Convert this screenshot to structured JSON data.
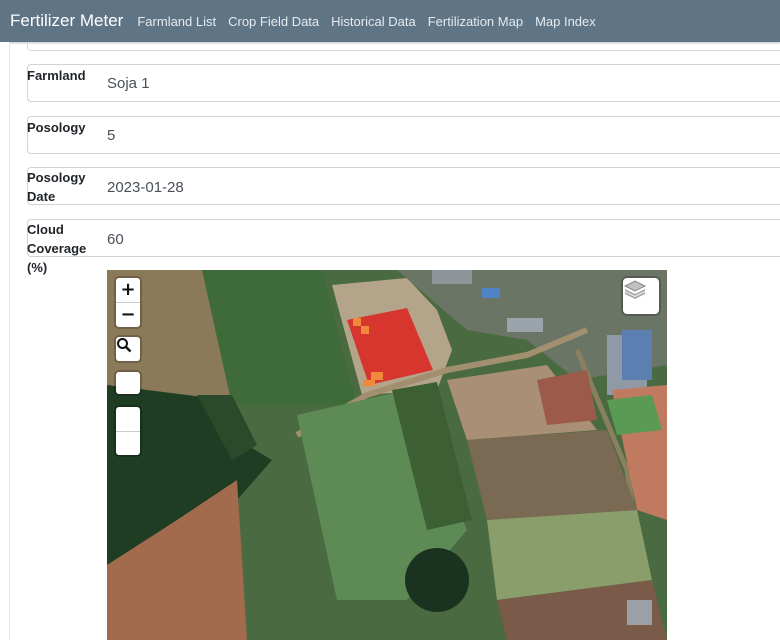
{
  "navbar": {
    "brand": "Fertilizer Meter",
    "links": [
      "Farmland List",
      "Crop Field Data",
      "Historical Data",
      "Fertilization Map",
      "Map Index"
    ]
  },
  "form": {
    "farmland": {
      "label": "Farmland",
      "value": "Soja 1"
    },
    "posology": {
      "label": "Posology",
      "value": "5"
    },
    "posology_date": {
      "label_line1": "Posology",
      "label_line2": "Date",
      "value": "2023-01-28"
    },
    "cloud_coverage": {
      "label_line1": "Cloud",
      "label_line2": "Coverage",
      "label_line3": "(%)",
      "value": "60"
    }
  },
  "map": {
    "zoom_in": "+",
    "zoom_out": "−",
    "icons": [
      "search-icon",
      "layers-icon"
    ],
    "field_color": "#d9302a",
    "field_accent_color": "#f08a3a"
  }
}
